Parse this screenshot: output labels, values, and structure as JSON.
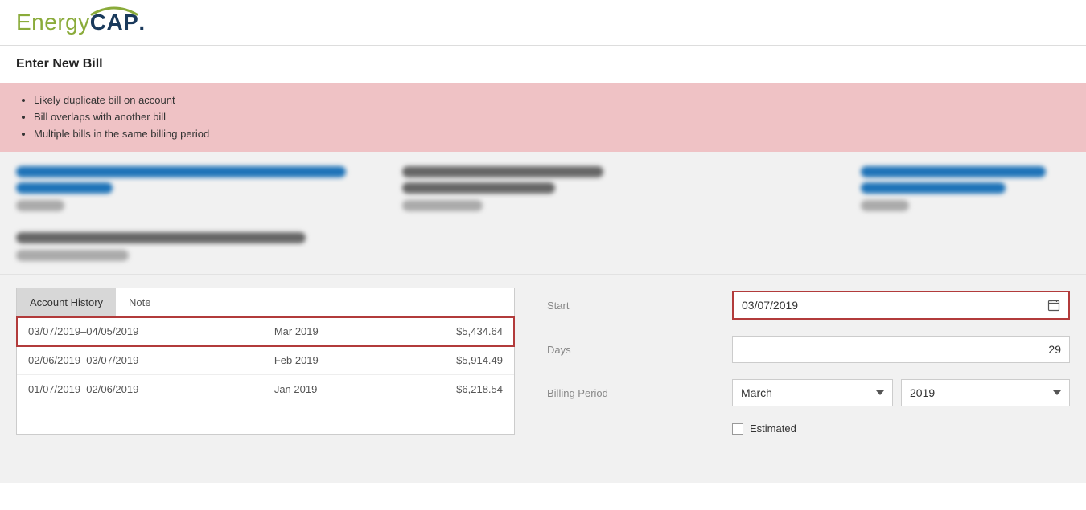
{
  "logo": {
    "left": "Energy",
    "right": "CAP",
    "dot": "."
  },
  "page_title": "Enter New Bill",
  "alerts": [
    "Likely duplicate bill on account",
    "Bill overlaps with another bill",
    "Multiple bills in the same billing period"
  ],
  "tabs": {
    "account_history": "Account History",
    "note": "Note"
  },
  "history_rows": [
    {
      "range": "03/07/2019–04/05/2019",
      "period": "Mar 2019",
      "amount": "$5,434.64",
      "highlighted": true
    },
    {
      "range": "02/06/2019–03/07/2019",
      "period": "Feb 2019",
      "amount": "$5,914.49",
      "highlighted": false
    },
    {
      "range": "01/07/2019–02/06/2019",
      "period": "Jan 2019",
      "amount": "$6,218.54",
      "highlighted": false
    }
  ],
  "form": {
    "start_label": "Start",
    "start_value": "03/07/2019",
    "days_label": "Days",
    "days_value": "29",
    "billing_period_label": "Billing Period",
    "month_value": "March",
    "year_value": "2019",
    "estimated_label": "Estimated"
  }
}
